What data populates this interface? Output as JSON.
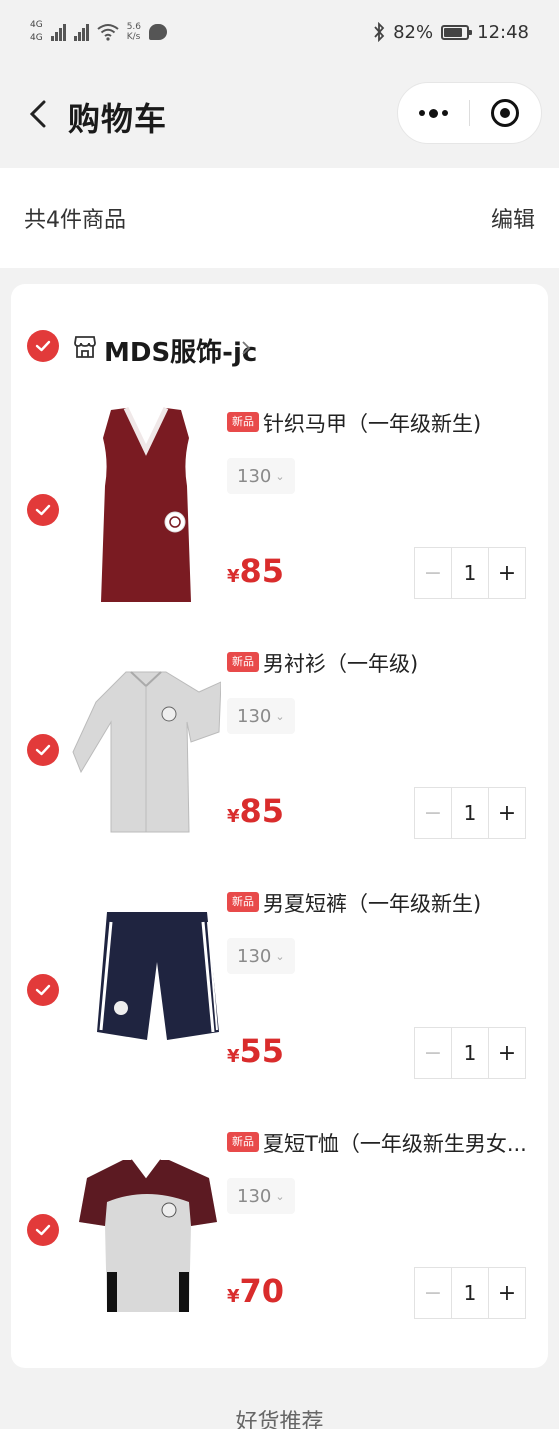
{
  "status_bar": {
    "sim1": "4G",
    "sim2": "4G",
    "speed_value": "5.6",
    "speed_unit": "K/s",
    "battery": "82%",
    "battery_level": 0.82,
    "time": "12:48"
  },
  "nav": {
    "title": "购物车"
  },
  "summary": {
    "count_text": "共4件商品",
    "edit_label": "编辑"
  },
  "store": {
    "name": "MDS服饰-jc"
  },
  "items": [
    {
      "tag": "新品",
      "title": "针织马甲（一年级新生)",
      "spec": "130",
      "currency": "¥",
      "price": "85",
      "qty": "1",
      "minus": "−",
      "plus": "+",
      "selected": true
    },
    {
      "tag": "新品",
      "title": "男衬衫（一年级)",
      "spec": "130",
      "currency": "¥",
      "price": "85",
      "qty": "1",
      "minus": "−",
      "plus": "+",
      "selected": true
    },
    {
      "tag": "新品",
      "title": "男夏短裤（一年级新生)",
      "spec": "130",
      "currency": "¥",
      "price": "55",
      "qty": "1",
      "minus": "−",
      "plus": "+",
      "selected": true
    },
    {
      "tag": "新品",
      "title": "夏短T恤（一年级新生男女...",
      "spec": "130",
      "currency": "¥",
      "price": "70",
      "qty": "1",
      "minus": "−",
      "plus": "+",
      "selected": true
    }
  ],
  "recommend": {
    "label": "好货推荐"
  },
  "colors": {
    "accent": "#e23a3a",
    "price": "#d92c2c",
    "background": "#f2f2f2"
  }
}
